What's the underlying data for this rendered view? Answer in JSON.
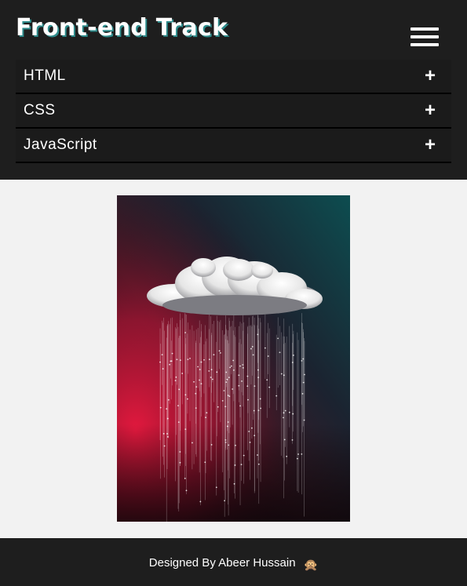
{
  "header": {
    "title": "Front-end Track",
    "menu_icon": "hamburger-menu-icon"
  },
  "accordion": {
    "items": [
      {
        "label": "HTML",
        "toggle": "+"
      },
      {
        "label": "CSS",
        "toggle": "+"
      },
      {
        "label": "JavaScript",
        "toggle": "+"
      }
    ]
  },
  "hero_image": {
    "subject": "rain-cloud illustration",
    "colors": {
      "top": "#0c4a4d",
      "middle": "#cc1a3a",
      "bottom": "#0e0a0d"
    }
  },
  "footer": {
    "text": "Designed By Abeer Hussain",
    "emoji": "🙊"
  },
  "colors": {
    "header_bg": "#1e1e1e",
    "page_bg": "#f2f2f2",
    "title_shadow": "#2e8b8b"
  }
}
